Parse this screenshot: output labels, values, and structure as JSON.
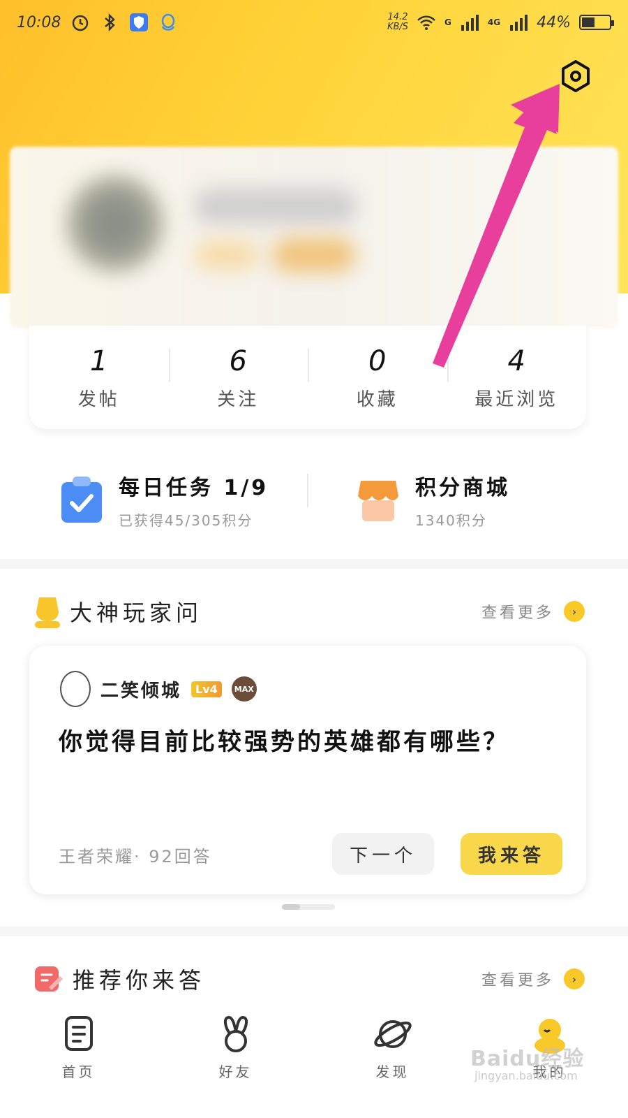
{
  "status_bar": {
    "time": "10:08",
    "speed_value": "14.2",
    "speed_unit": "KB/S",
    "network_1": "G",
    "network_2": "4G",
    "battery": "44%"
  },
  "stats": [
    {
      "value": "1",
      "label": "发帖"
    },
    {
      "value": "6",
      "label": "关注"
    },
    {
      "value": "0",
      "label": "收藏"
    },
    {
      "value": "4",
      "label": "最近浏览"
    }
  ],
  "tasks": {
    "daily": {
      "title": "每日任务 1/9",
      "subtitle": "已获得45/305积分"
    },
    "store": {
      "title": "积分商城",
      "subtitle": "1340积分"
    }
  },
  "expert_section": {
    "title": "大神玩家问",
    "more": "查看更多",
    "card": {
      "username": "二笑倾城",
      "level": "Lv4",
      "badge": "MAX",
      "question": "你觉得目前比较强势的英雄都有哪些？",
      "meta": "王者荣耀· 92回答",
      "next_button": "下一个",
      "answer_button": "我来答"
    }
  },
  "recommend_section": {
    "title": "推荐你来答",
    "more": "查看更多"
  },
  "bottom_nav": [
    {
      "label": "首页",
      "icon": "home-doc-icon"
    },
    {
      "label": "好友",
      "icon": "friends-bunny-icon"
    },
    {
      "label": "发现",
      "icon": "planet-icon"
    },
    {
      "label": "我的",
      "icon": "duck-avatar-icon"
    }
  ],
  "watermark": {
    "text": "Baidu经验",
    "url": "jingyan.baidu.com"
  },
  "colors": {
    "accent_yellow": "#f8d74a",
    "arrow_pink": "#e83e9c",
    "header_gradient_start": "#ffc02a",
    "header_gradient_end": "#ffe45a"
  }
}
